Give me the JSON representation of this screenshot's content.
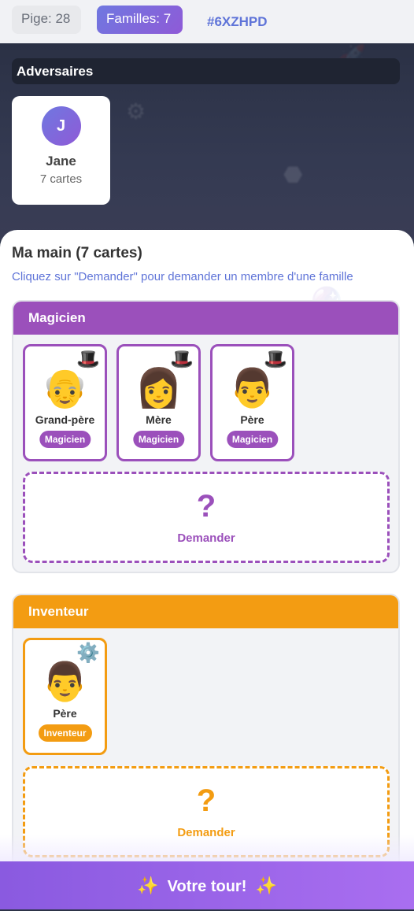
{
  "stats": {
    "pile": "Pige: 28",
    "families": "Familles: 7",
    "room_code": "#6XZHPD"
  },
  "opponents": {
    "title": "Adversaires",
    "players": [
      {
        "initial": "J",
        "name": "Jane",
        "count": "7 cartes"
      }
    ]
  },
  "hand": {
    "title": "Ma main (7 cartes)",
    "hint": "Cliquez sur \"Demander\" pour demander un membre d'une famille",
    "families": [
      {
        "name": "Magicien",
        "color": "#9b50bb",
        "icon": "🎩",
        "cards": [
          {
            "face": "👴",
            "name": "Grand-père",
            "tag": "Magicien"
          },
          {
            "face": "👩",
            "name": "Mère",
            "tag": "Magicien"
          },
          {
            "face": "👨",
            "name": "Père",
            "tag": "Magicien"
          }
        ],
        "ask": {
          "symbol": "?",
          "label": "Demander"
        }
      },
      {
        "name": "Inventeur",
        "color": "#f39c12",
        "icon": "⚙️",
        "cards": [
          {
            "face": "👨",
            "name": "Père",
            "tag": "Inventeur"
          }
        ],
        "ask": {
          "symbol": "?",
          "label": "Demander"
        }
      }
    ]
  },
  "turn": {
    "label": "Votre tour!",
    "spark": "✨"
  }
}
